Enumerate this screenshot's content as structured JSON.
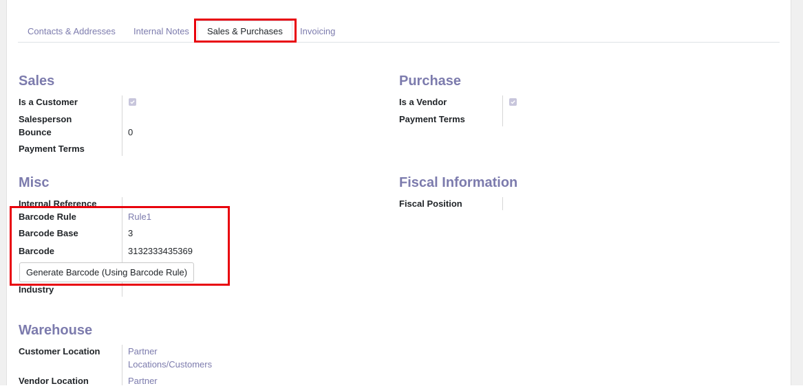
{
  "tabs": [
    {
      "label": "Contacts & Addresses"
    },
    {
      "label": "Internal Notes"
    },
    {
      "label": "Sales & Purchases",
      "active": true
    },
    {
      "label": "Invoicing"
    }
  ],
  "sales": {
    "title": "Sales",
    "is_customer_label": "Is a Customer",
    "is_customer_checked": true,
    "salesperson_label": "Salesperson",
    "bounce_label": "Bounce",
    "bounce_value": "0",
    "payment_terms_label": "Payment Terms"
  },
  "purchase": {
    "title": "Purchase",
    "is_vendor_label": "Is a Vendor",
    "is_vendor_checked": true,
    "payment_terms_label": "Payment Terms"
  },
  "misc": {
    "title": "Misc",
    "internal_reference_label": "Internal Reference",
    "barcode_rule_label": "Barcode Rule",
    "barcode_rule_value": "Rule1",
    "barcode_base_label": "Barcode Base",
    "barcode_base_value": "3",
    "barcode_label": "Barcode",
    "barcode_value": "3132333435369",
    "generate_button_label": "Generate Barcode (Using Barcode Rule)",
    "industry_label": "Industry"
  },
  "fiscal": {
    "title": "Fiscal Information",
    "fiscal_position_label": "Fiscal Position"
  },
  "warehouse": {
    "title": "Warehouse",
    "customer_location_label": "Customer Location",
    "customer_location_line1": "Partner",
    "customer_location_line2": "Locations/Customers",
    "vendor_location_label": "Vendor Location",
    "vendor_location_line1": "Partner"
  },
  "colors": {
    "accent": "#7c7bad",
    "highlight": "#e8000b",
    "checkbox": "#c8c6dc"
  }
}
